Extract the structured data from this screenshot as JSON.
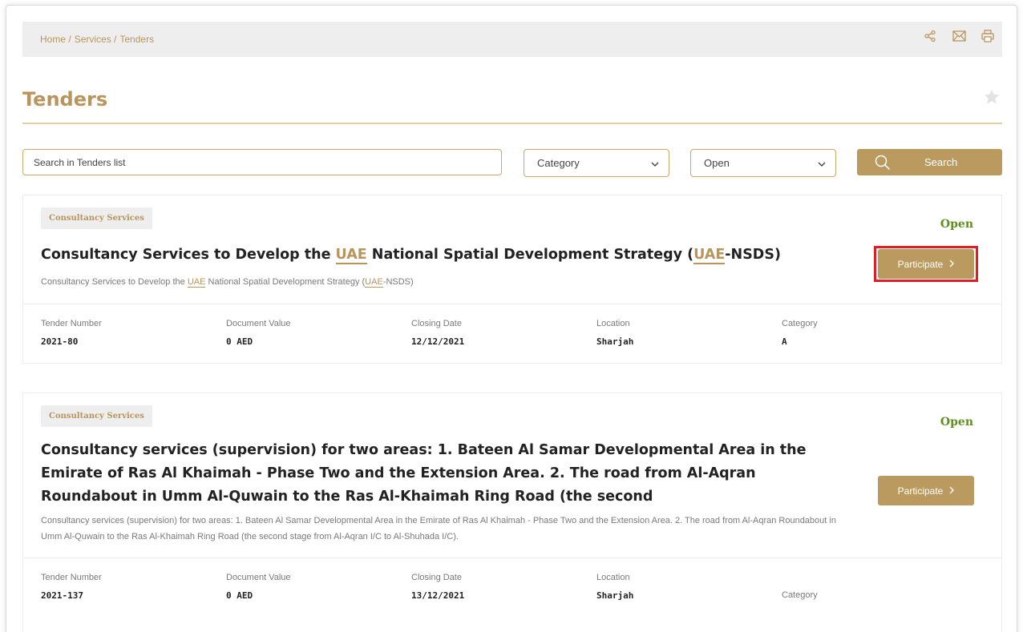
{
  "breadcrumb": [
    "Home /",
    "Services /",
    "Tenders"
  ],
  "page_title": "Tenders",
  "search": {
    "placeholder": "Search in Tenders list",
    "category_selected": "Category",
    "status_selected": "Open",
    "button_label": "Search"
  },
  "icons": {
    "share": "share-icon",
    "email": "envelope-icon",
    "print": "printer-icon",
    "favorite": "star-icon",
    "search": "search-icon",
    "dropdown": "chevron-down-icon"
  },
  "colors": {
    "accent": "#bb9a5f",
    "status_open": "#5f8f1f",
    "highlight": "#e11d26"
  },
  "meta_labels": {
    "tender_number": "Tender Number",
    "document_value": "Document Value",
    "closing_date": "Closing Date",
    "location": "Location",
    "category": "Category"
  },
  "tenders": [
    {
      "badge": "Consultancy Services",
      "status": "Open",
      "title_parts": [
        "Consultancy Services to Develop the ",
        "UAE",
        " National Spatial Development Strategy (",
        "UAE",
        "-NSDS)"
      ],
      "desc_parts": [
        "Consultancy Services to Develop the ",
        "UAE",
        " National Spatial Development Strategy (",
        "UAE",
        "-NSDS)"
      ],
      "participate_label": "Participate",
      "tender_number": "2021-80",
      "document_value": "0 AED",
      "closing_date": "12/12/2021",
      "location": "Sharjah",
      "category": "A"
    },
    {
      "badge": "Consultancy Services",
      "status": "Open",
      "title": "Consultancy services (supervision) for two areas: 1. Bateen Al Samar Developmental Area in the Emirate of Ras Al Khaimah - Phase Two and the Extension Area. 2. The road from Al-Aqran Roundabout in Umm Al-Quwain to the Ras Al-Khaimah Ring Road (the second",
      "description": "Consultancy services (supervision) for two areas: 1. Bateen Al Samar Developmental Area in the Emirate of Ras Al Khaimah - Phase Two and the Extension Area. 2. The road from Al-Aqran Roundabout in Umm Al-Quwain to the Ras Al-Khaimah Ring Road (the second stage from Al-Aqran I/C to Al-Shuhada I/C).",
      "participate_label": "Participate",
      "tender_number": "2021-137",
      "document_value": "0 AED",
      "closing_date": "13/12/2021",
      "location": "Sharjah"
    }
  ]
}
